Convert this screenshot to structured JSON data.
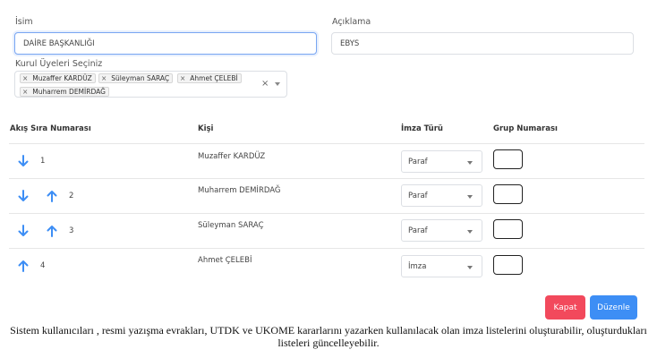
{
  "form": {
    "name_label": "İsim",
    "name_value": "DAİRE BAŞKANLIĞI",
    "desc_label": "Açıklama",
    "desc_value": "EBYS",
    "members_label": "Kurul Üyeleri Seçiniz",
    "members": [
      "Muzaffer KARDÜZ",
      "Süleyman SARAÇ",
      "Ahmet ÇELEBİ",
      "Muharrem DEMİRDAĞ"
    ],
    "tag_remove_icon": "×",
    "clear_icon": "×"
  },
  "table": {
    "headers": {
      "order": "Akış Sıra Numarası",
      "person": "Kişi",
      "signature": "İmza Türü",
      "group": "Grup Numarası"
    },
    "rows": [
      {
        "order": "1",
        "person": "Muzaffer KARDÜZ",
        "signature": "Paraf",
        "group": "",
        "icons": [
          "arrow-down-icon"
        ]
      },
      {
        "order": "2",
        "person": "Muharrem DEMİRDAĞ",
        "signature": "Paraf",
        "group": "",
        "icons": [
          "arrow-down-icon",
          "arrow-up-icon"
        ]
      },
      {
        "order": "3",
        "person": "Süleyman SARAÇ",
        "signature": "Paraf",
        "group": "",
        "icons": [
          "arrow-down-icon",
          "arrow-up-icon"
        ]
      },
      {
        "order": "4",
        "person": "Ahmet ÇELEBİ",
        "signature": "İmza",
        "group": "",
        "icons": [
          "arrow-up-icon"
        ]
      }
    ]
  },
  "buttons": {
    "close": "Kapat",
    "edit": "Düzenle"
  },
  "colors": {
    "arrow": "#3d8ef5",
    "close_button": "#f2495c",
    "edit_button": "#3d8ef5"
  },
  "caption": "Sistem kullanıcıları , resmi yazışma evrakları, UTDK ve UKOME kararlarını yazarken kullanılacak olan imza listelerini oluşturabilir, oluşturdukları listeleri güncelleyebilir."
}
